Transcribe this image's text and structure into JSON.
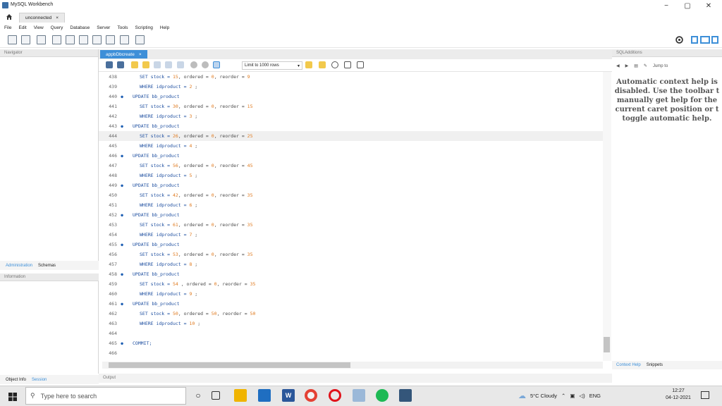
{
  "window": {
    "title": "MySQL Workbench",
    "minimize": "−",
    "maximize": "▢",
    "close": "✕"
  },
  "connection_tab": {
    "label": "unconnected",
    "close": "×"
  },
  "menu": [
    "File",
    "Edit",
    "View",
    "Query",
    "Database",
    "Server",
    "Tools",
    "Scripting",
    "Help"
  ],
  "navigator": {
    "title": "Navigator",
    "tabs": [
      "Administration",
      "Schemas"
    ],
    "info_title": "Information",
    "bottom_tabs": [
      "Object Info",
      "Session"
    ]
  },
  "editor": {
    "tab_label": "appbDbcreate",
    "tab_close": "×",
    "limit": "Limit to 1000 rows",
    "output_title": "Output",
    "lines": [
      {
        "n": "438",
        "m": "",
        "parts": [
          [
            "SET stock = ",
            ""
          ],
          [
            "15",
            "num"
          ],
          [
            ", ordered = ",
            ""
          ],
          [
            "0",
            "num"
          ],
          [
            ", reorder = ",
            ""
          ],
          [
            "9",
            "num"
          ]
        ],
        "indent": 1
      },
      {
        "n": "439",
        "m": "",
        "parts": [
          [
            "WHERE idproduct = ",
            ""
          ],
          [
            "2",
            "num"
          ],
          [
            " ;",
            ""
          ]
        ],
        "indent": 1
      },
      {
        "n": "440",
        "m": "●",
        "parts": [
          [
            "UPDATE bb_product",
            "kw"
          ]
        ],
        "indent": 0
      },
      {
        "n": "441",
        "m": "",
        "parts": [
          [
            "SET stock = ",
            ""
          ],
          [
            "30",
            "num"
          ],
          [
            ", ordered = ",
            ""
          ],
          [
            "0",
            "num"
          ],
          [
            ", reorder = ",
            ""
          ],
          [
            "15",
            "num"
          ]
        ],
        "indent": 1
      },
      {
        "n": "442",
        "m": "",
        "parts": [
          [
            "WHERE idproduct = ",
            ""
          ],
          [
            "3",
            "num"
          ],
          [
            " ;",
            ""
          ]
        ],
        "indent": 1
      },
      {
        "n": "443",
        "m": "●",
        "parts": [
          [
            "UPDATE bb_product",
            "kw"
          ]
        ],
        "indent": 0
      },
      {
        "n": "444",
        "m": "",
        "parts": [
          [
            "SET stock = ",
            ""
          ],
          [
            "26",
            "num"
          ],
          [
            ", ordered = ",
            ""
          ],
          [
            "0",
            "num"
          ],
          [
            ", reorder = ",
            ""
          ],
          [
            "25",
            "num"
          ]
        ],
        "indent": 1,
        "current": true
      },
      {
        "n": "445",
        "m": "",
        "parts": [
          [
            "WHERE idproduct = ",
            ""
          ],
          [
            "4",
            "num"
          ],
          [
            " ;",
            ""
          ]
        ],
        "indent": 1
      },
      {
        "n": "446",
        "m": "●",
        "parts": [
          [
            "UPDATE bb_product",
            "kw"
          ]
        ],
        "indent": 0
      },
      {
        "n": "447",
        "m": "",
        "parts": [
          [
            "SET stock = ",
            ""
          ],
          [
            "56",
            "num"
          ],
          [
            ", ordered = ",
            ""
          ],
          [
            "0",
            "num"
          ],
          [
            ", reorder = ",
            ""
          ],
          [
            "45",
            "num"
          ]
        ],
        "indent": 1
      },
      {
        "n": "448",
        "m": "",
        "parts": [
          [
            "WHERE idproduct = ",
            ""
          ],
          [
            "5",
            "num"
          ],
          [
            " ;",
            ""
          ]
        ],
        "indent": 1
      },
      {
        "n": "449",
        "m": "●",
        "parts": [
          [
            "UPDATE bb_product",
            "kw"
          ]
        ],
        "indent": 0
      },
      {
        "n": "450",
        "m": "",
        "parts": [
          [
            "SET stock = ",
            ""
          ],
          [
            "42",
            "num"
          ],
          [
            ", ordered = ",
            ""
          ],
          [
            "0",
            "num"
          ],
          [
            ", reorder = ",
            ""
          ],
          [
            "35",
            "num"
          ]
        ],
        "indent": 1
      },
      {
        "n": "451",
        "m": "",
        "parts": [
          [
            "WHERE idproduct = ",
            ""
          ],
          [
            "6",
            "num"
          ],
          [
            " ;",
            ""
          ]
        ],
        "indent": 1
      },
      {
        "n": "452",
        "m": "●",
        "parts": [
          [
            "UPDATE bb_product",
            "kw"
          ]
        ],
        "indent": 0
      },
      {
        "n": "453",
        "m": "",
        "parts": [
          [
            "SET stock = ",
            ""
          ],
          [
            "61",
            "num"
          ],
          [
            ", ordered = ",
            ""
          ],
          [
            "0",
            "num"
          ],
          [
            ", reorder = ",
            ""
          ],
          [
            "35",
            "num"
          ]
        ],
        "indent": 1
      },
      {
        "n": "454",
        "m": "",
        "parts": [
          [
            "WHERE idproduct = ",
            ""
          ],
          [
            "7",
            "num"
          ],
          [
            " ;",
            ""
          ]
        ],
        "indent": 1
      },
      {
        "n": "455",
        "m": "●",
        "parts": [
          [
            "UPDATE bb_product",
            "kw"
          ]
        ],
        "indent": 0
      },
      {
        "n": "456",
        "m": "",
        "parts": [
          [
            "SET stock = ",
            ""
          ],
          [
            "53",
            "num"
          ],
          [
            ", ordered = ",
            ""
          ],
          [
            "0",
            "num"
          ],
          [
            ", reorder = ",
            ""
          ],
          [
            "35",
            "num"
          ]
        ],
        "indent": 1
      },
      {
        "n": "457",
        "m": "",
        "parts": [
          [
            "WHERE idproduct = ",
            ""
          ],
          [
            "8",
            "num"
          ],
          [
            " ;",
            ""
          ]
        ],
        "indent": 1
      },
      {
        "n": "458",
        "m": "●",
        "parts": [
          [
            "UPDATE bb_product",
            "kw"
          ]
        ],
        "indent": 0
      },
      {
        "n": "459",
        "m": "",
        "parts": [
          [
            "SET stock = ",
            ""
          ],
          [
            "54",
            "num"
          ],
          [
            " , ordered = ",
            ""
          ],
          [
            "0",
            "num"
          ],
          [
            ", reorder = ",
            ""
          ],
          [
            "35",
            "num"
          ]
        ],
        "indent": 1
      },
      {
        "n": "460",
        "m": "",
        "parts": [
          [
            "WHERE idproduct = ",
            ""
          ],
          [
            "9",
            "num"
          ],
          [
            " ;",
            ""
          ]
        ],
        "indent": 1
      },
      {
        "n": "461",
        "m": "●",
        "parts": [
          [
            "UPDATE bb_product",
            "kw"
          ]
        ],
        "indent": 0
      },
      {
        "n": "462",
        "m": "",
        "parts": [
          [
            "SET stock = ",
            ""
          ],
          [
            "50",
            "num"
          ],
          [
            ", ordered = ",
            ""
          ],
          [
            "50",
            "num"
          ],
          [
            ", reorder = ",
            ""
          ],
          [
            "50",
            "num"
          ]
        ],
        "indent": 1
      },
      {
        "n": "463",
        "m": "",
        "parts": [
          [
            "WHERE idproduct = ",
            ""
          ],
          [
            "10",
            "num"
          ],
          [
            " ;",
            ""
          ]
        ],
        "indent": 1
      },
      {
        "n": "464",
        "m": "",
        "parts": [],
        "indent": 0
      },
      {
        "n": "465",
        "m": "●",
        "parts": [
          [
            "COMMIT;",
            "kw"
          ]
        ],
        "indent": 0
      },
      {
        "n": "466",
        "m": "",
        "parts": [],
        "indent": 0
      }
    ]
  },
  "sql_additions": {
    "title": "SQLAdditions",
    "jump_to": "Jump to",
    "help_text": [
      "Automatic context help is",
      "disabled. Use the toolbar t",
      "manually get help for the",
      "current caret position or t",
      "toggle automatic help."
    ],
    "tabs": [
      "Context Help",
      "Snippets"
    ]
  },
  "taskbar": {
    "search_placeholder": "Type here to search",
    "weather": "5°C  Cloudy",
    "lang": "ENG",
    "time": "12:27",
    "date": "04-12-2021"
  },
  "colors": {
    "accent": "#3d8fd8",
    "keyword": "#1e4fa0",
    "number": "#e07b20"
  }
}
